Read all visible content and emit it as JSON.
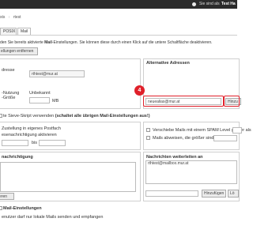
{
  "topbar": {
    "status_text": "Sie sind als",
    "user_name": "Test Ha"
  },
  "breadcrumb": {
    "items": [
      "sts",
      "rtest"
    ]
  },
  "tabs": [
    "POSIX",
    "Mail"
  ],
  "intro": {
    "pre": "den Sie bereits aktivierte ",
    "bold": "Mail",
    "post": "-Einstellungen. Sie können diese durch einen Klick auf die untere Schaltfläche deaktivieren."
  },
  "remove_settings_button": "ellungen entfernen",
  "left": {
    "address_label": "dresse",
    "address_value": "rthtest@mur.at",
    "usage_label": "-Nutzung",
    "usage_value": "Unbekannt",
    "size_label": "-Größe",
    "size_unit": "MB"
  },
  "alt_addresses": {
    "title": "Alternative Adressen",
    "input_value": "neuealias@mur.at",
    "add_button": "Hinzu",
    "step_badge": "4"
  },
  "sieve": {
    "text": "te Sieve-Skript verwenden ",
    "bold": "(schaltet alle übrigen Mail-Einstellungen aus!)"
  },
  "delivery": {
    "line1": "Zustellung in eigenes Postfach",
    "line2": "esenachrichtigung aktivieren",
    "bis_label": "bis"
  },
  "spam": {
    "line1": "Verschiebe Mails mit einem SPAM Level größer als",
    "line2": "Mails abweisen, die größer sind als"
  },
  "notify": {
    "title": "nachrichtigung",
    "button": "eren"
  },
  "forward": {
    "title": "Nachrichten weiterleiten an",
    "list_item": "rthtest@mailbox.mur.at",
    "add_button": "Hinzufügen",
    "delete_button": "Lö"
  },
  "bottom": {
    "title": "Mail-Einstellungen",
    "text": "enutzer darf nur lokale Mails senden und empfangen"
  }
}
